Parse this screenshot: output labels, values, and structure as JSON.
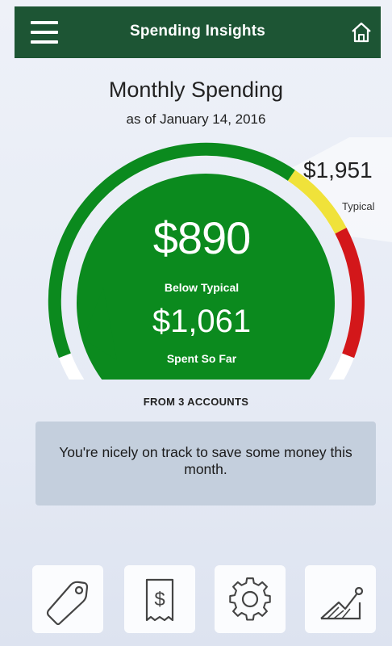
{
  "header": {
    "title": "Spending Insights"
  },
  "summary": {
    "title": "Monthly Spending",
    "as_of": "as of January 14, 2016",
    "main_amount": "$890",
    "main_status": "Below Typical",
    "spent_amount": "$1,061",
    "spent_label": "Spent So Far",
    "typical_amount": "$1,951",
    "typical_label": "Typical",
    "accounts_label": "FROM 3 ACCOUNTS"
  },
  "gauge": {
    "spent_amount": 1061,
    "typical_amount": 1951,
    "colors": {
      "green": "#0b8a1e",
      "yellow": "#f0e23a",
      "red": "#d3171a",
      "track": "#ffffff"
    }
  },
  "message": "You're nicely on track to save some money this month.",
  "bottom_nav": [
    {
      "icon": "tag-icon"
    },
    {
      "icon": "receipt-icon"
    },
    {
      "icon": "gear-icon"
    },
    {
      "icon": "chart-trend-icon"
    }
  ]
}
